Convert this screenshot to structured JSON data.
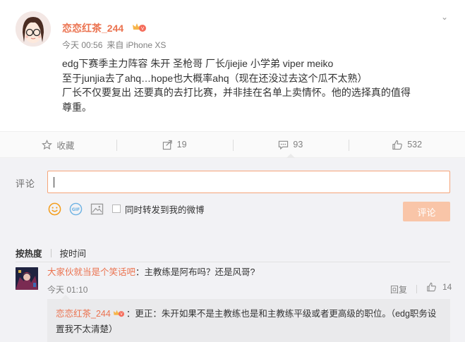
{
  "post": {
    "username": "恋恋红茶_244",
    "time": "今天 00:56",
    "source": "来自 iPhone XS",
    "body_lines": [
      "edg下赛季主力阵容 朱开 圣枪哥 厂长/jiejie 小学弟 viper meiko",
      "至于junjia去了ahq…hope也大概率ahq（现在还没过去这个瓜不太熟）",
      "厂长不仅要复出 还要真的去打比赛，并非挂在名单上卖情怀。他的选择真的值得",
      "尊重。"
    ]
  },
  "actions": {
    "favorite": "收藏",
    "forward": "19",
    "comment": "93",
    "like": "532"
  },
  "composer": {
    "label": "评论",
    "forward_label": "同时转发到我的微博",
    "submit": "评论"
  },
  "sort": {
    "by_hot": "按热度",
    "by_time": "按时间"
  },
  "comment": {
    "user": "大家伙就当是个笑话吧",
    "text": "：主教练是阿布吗？还是风哥?",
    "time": "今天 01:10",
    "reply_label": "回复",
    "likes": "14"
  },
  "reply": {
    "user": "恋恋红茶_244",
    "text": "：更正：朱开如果不是主教练也是和主教练平级或者更高级的职位。（edg职务设置我不太清楚）"
  },
  "colors": {
    "accent": "#eb7350",
    "submit_disabled": "#f9c5a8",
    "input_border": "#f5a478"
  }
}
